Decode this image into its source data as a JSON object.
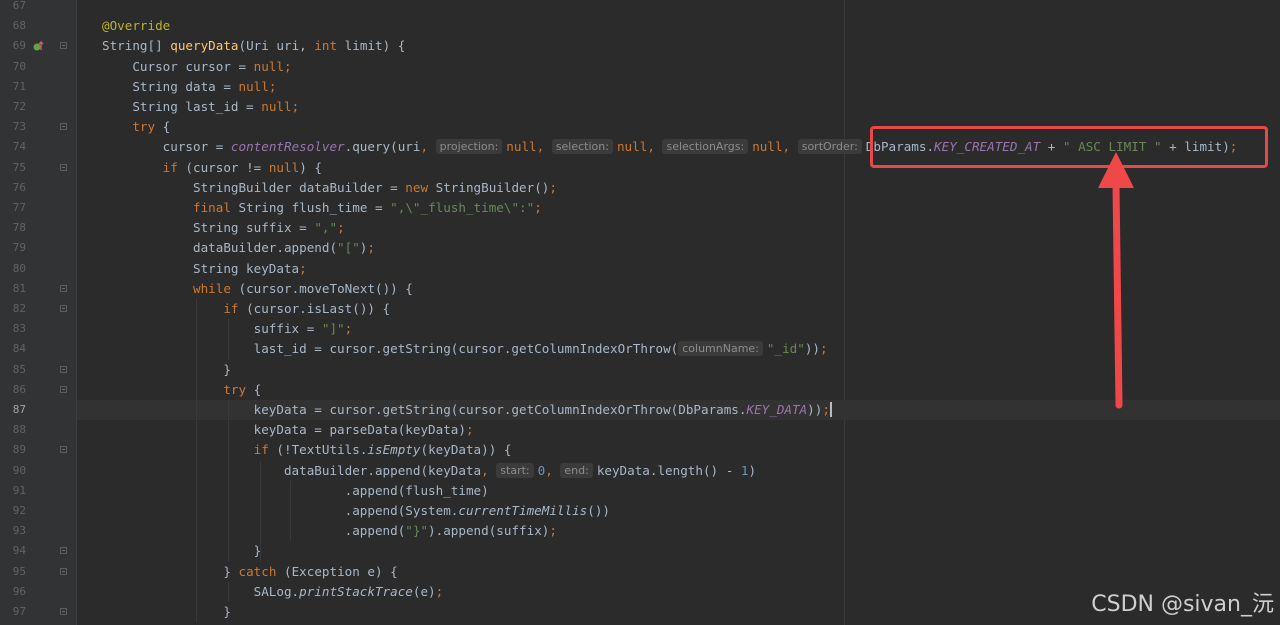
{
  "watermark": "CSDN @sivan_沅",
  "lines": [
    {
      "num": "67",
      "tokens": []
    },
    {
      "num": "68",
      "tokens": [
        {
          "t": "@Override",
          "c": "a"
        }
      ]
    },
    {
      "num": "69",
      "tokens": [
        {
          "t": "String[] "
        },
        {
          "t": "queryData",
          "c": "f"
        },
        {
          "t": "(Uri uri, "
        },
        {
          "t": "int",
          "c": "k"
        },
        {
          "t": " limit) {"
        }
      ]
    },
    {
      "num": "70",
      "tokens": [
        {
          "t": "    Cursor cursor = "
        },
        {
          "t": "null",
          "c": "k"
        },
        {
          "t": ";",
          "c": "k"
        }
      ]
    },
    {
      "num": "71",
      "tokens": [
        {
          "t": "    String data = "
        },
        {
          "t": "null",
          "c": "k"
        },
        {
          "t": ";",
          "c": "k"
        }
      ]
    },
    {
      "num": "72",
      "tokens": [
        {
          "t": "    String last_id = "
        },
        {
          "t": "null",
          "c": "k"
        },
        {
          "t": ";",
          "c": "k"
        }
      ]
    },
    {
      "num": "73",
      "tokens": [
        {
          "t": "    "
        },
        {
          "t": "try",
          "c": "k"
        },
        {
          "t": " {"
        }
      ]
    },
    {
      "num": "74",
      "tokens": [
        {
          "t": "        cursor = "
        },
        {
          "t": "contentResolver",
          "c": "c"
        },
        {
          "t": ".query(uri"
        },
        {
          "t": ", ",
          "c": "k"
        },
        {
          "h": "projection:"
        },
        {
          "t": "null",
          "c": "k"
        },
        {
          "t": ", ",
          "c": "k"
        },
        {
          "h": "selection:"
        },
        {
          "t": "null",
          "c": "k"
        },
        {
          "t": ", ",
          "c": "k"
        },
        {
          "h": "selectionArgs:"
        },
        {
          "t": "null",
          "c": "k"
        },
        {
          "t": ", ",
          "c": "k"
        },
        {
          "h": "sortOrder:"
        },
        {
          "t": "DbParams."
        },
        {
          "t": "KEY_CREATED_AT",
          "c": "c"
        },
        {
          "t": " + "
        },
        {
          "t": "\" ASC LIMIT \"",
          "c": "s"
        },
        {
          "t": " + limit)"
        },
        {
          "t": ";",
          "c": "k"
        }
      ]
    },
    {
      "num": "75",
      "tokens": [
        {
          "t": "        "
        },
        {
          "t": "if",
          "c": "k"
        },
        {
          "t": " (cursor != "
        },
        {
          "t": "null",
          "c": "k"
        },
        {
          "t": ") {"
        }
      ]
    },
    {
      "num": "76",
      "tokens": [
        {
          "t": "            StringBuilder dataBuilder = "
        },
        {
          "t": "new",
          "c": "k"
        },
        {
          "t": " StringBuilder()"
        },
        {
          "t": ";",
          "c": "k"
        }
      ]
    },
    {
      "num": "77",
      "tokens": [
        {
          "t": "            "
        },
        {
          "t": "final",
          "c": "k"
        },
        {
          "t": " String flush_time = "
        },
        {
          "t": "\",\\\"_flush_time\\\":\"",
          "c": "s"
        },
        {
          "t": ";",
          "c": "k"
        }
      ]
    },
    {
      "num": "78",
      "tokens": [
        {
          "t": "            String suffix = "
        },
        {
          "t": "\",\"",
          "c": "s"
        },
        {
          "t": ";",
          "c": "k"
        }
      ]
    },
    {
      "num": "79",
      "tokens": [
        {
          "t": "            dataBuilder.append("
        },
        {
          "t": "\"[\"",
          "c": "s"
        },
        {
          "t": ")"
        },
        {
          "t": ";",
          "c": "k"
        }
      ]
    },
    {
      "num": "80",
      "tokens": [
        {
          "t": "            String keyData"
        },
        {
          "t": ";",
          "c": "k"
        }
      ]
    },
    {
      "num": "81",
      "tokens": [
        {
          "t": "            "
        },
        {
          "t": "while",
          "c": "k"
        },
        {
          "t": " (cursor.moveToNext()) {"
        }
      ]
    },
    {
      "num": "82",
      "tokens": [
        {
          "t": "                "
        },
        {
          "t": "if",
          "c": "k"
        },
        {
          "t": " (cursor.isLast()) {"
        }
      ]
    },
    {
      "num": "83",
      "tokens": [
        {
          "t": "                    suffix = "
        },
        {
          "t": "\"]\"",
          "c": "s"
        },
        {
          "t": ";",
          "c": "k"
        }
      ]
    },
    {
      "num": "84",
      "tokens": [
        {
          "t": "                    last_id = cursor.getString(cursor.getColumnIndexOrThrow("
        },
        {
          "h": "columnName:"
        },
        {
          "t": "\"_id\"",
          "c": "s"
        },
        {
          "t": "))"
        },
        {
          "t": ";",
          "c": "k"
        }
      ]
    },
    {
      "num": "85",
      "tokens": [
        {
          "t": "                }"
        }
      ]
    },
    {
      "num": "86",
      "tokens": [
        {
          "t": "                "
        },
        {
          "t": "try",
          "c": "k"
        },
        {
          "t": " {"
        }
      ]
    },
    {
      "num": "87",
      "tokens": [
        {
          "t": "                    keyData = cursor.getString(cursor.getColumnIndexOrThrow(DbParams."
        },
        {
          "t": "KEY_DATA",
          "c": "c"
        },
        {
          "t": "))"
        },
        {
          "t": ";",
          "c": "k"
        },
        {
          "caret": true
        }
      ]
    },
    {
      "num": "88",
      "tokens": [
        {
          "t": "                    keyData = parseData(keyData)"
        },
        {
          "t": ";",
          "c": "k"
        }
      ]
    },
    {
      "num": "89",
      "tokens": [
        {
          "t": "                    "
        },
        {
          "t": "if",
          "c": "k"
        },
        {
          "t": " (!TextUtils."
        },
        {
          "t": "isEmpty",
          "c": "i"
        },
        {
          "t": "(keyData)) {"
        }
      ]
    },
    {
      "num": "90",
      "tokens": [
        {
          "t": "                        dataBuilder.append(keyData"
        },
        {
          "t": ", ",
          "c": "k"
        },
        {
          "h": "start:"
        },
        {
          "t": "0",
          "c": "n"
        },
        {
          "t": ", ",
          "c": "k"
        },
        {
          "h": "end:"
        },
        {
          "t": "keyData.length() - "
        },
        {
          "t": "1",
          "c": "n"
        },
        {
          "t": ")"
        }
      ]
    },
    {
      "num": "91",
      "tokens": [
        {
          "t": "                                .append(flush_time)"
        }
      ]
    },
    {
      "num": "92",
      "tokens": [
        {
          "t": "                                .append(System."
        },
        {
          "t": "currentTimeMillis",
          "c": "i"
        },
        {
          "t": "())"
        }
      ]
    },
    {
      "num": "93",
      "tokens": [
        {
          "t": "                                .append("
        },
        {
          "t": "\"}\"",
          "c": "s"
        },
        {
          "t": ").append(suffix)"
        },
        {
          "t": ";",
          "c": "k"
        }
      ]
    },
    {
      "num": "94",
      "tokens": [
        {
          "t": "                    }"
        }
      ]
    },
    {
      "num": "95",
      "tokens": [
        {
          "t": "                } "
        },
        {
          "t": "catch",
          "c": "k"
        },
        {
          "t": " (Exception e) {"
        }
      ]
    },
    {
      "num": "96",
      "tokens": [
        {
          "t": "                    SALog."
        },
        {
          "t": "printStackTrace",
          "c": "i"
        },
        {
          "t": "(e)"
        },
        {
          "t": ";",
          "c": "k"
        }
      ]
    },
    {
      "num": "97",
      "tokens": [
        {
          "t": "                }"
        }
      ]
    }
  ]
}
